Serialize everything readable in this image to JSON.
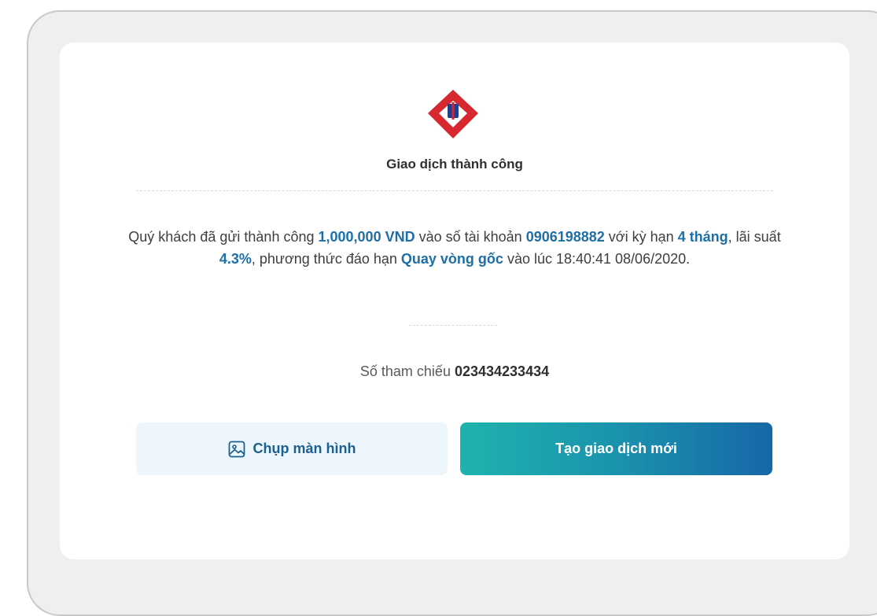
{
  "dialog": {
    "title": "Giao dịch thành công",
    "message": {
      "p1": "Quý khách đã gửi thành công ",
      "amount": "1,000,000 VND",
      "p2": " vào số tài khoản ",
      "account": "0906198882",
      "p3": " với kỳ hạn ",
      "term": "4 tháng",
      "p4": ", lãi suất ",
      "rate": "4.3%",
      "p5": ", phương thức đáo hạn ",
      "method": "Quay vòng gốc",
      "p6": " vào lúc 18:40:41 08/06/2020."
    },
    "reference_label": "Số tham chiếu ",
    "reference_number": "023434233434"
  },
  "buttons": {
    "screenshot_label": "Chụp màn hình",
    "new_transaction_label": "Tạo giao dịch mới"
  },
  "icons": {
    "logo": "bank-logo-icon",
    "screenshot": "image-icon"
  },
  "colors": {
    "highlight": "#1d6fa6",
    "logo_red": "#d7282f",
    "logo_blue": "#1f3f93",
    "primary_gradient_start": "#1fb3ad",
    "primary_gradient_end": "#1767a8",
    "secondary_button_bg": "#ecf6fc"
  }
}
